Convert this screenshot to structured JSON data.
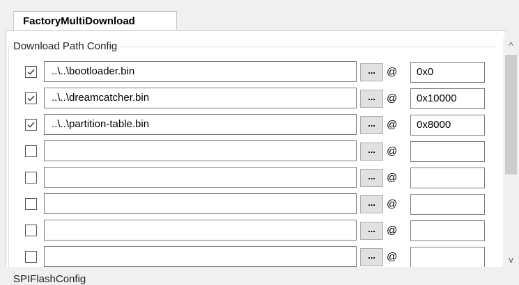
{
  "tab": {
    "label": "FactoryMultiDownload"
  },
  "group": {
    "title": "Download Path Config"
  },
  "browse_label": "...",
  "at_label": "@",
  "rows": [
    {
      "checked": true,
      "path": "..\\..\\bootloader.bin",
      "address": "0x0"
    },
    {
      "checked": true,
      "path": "..\\..\\dreamcatcher.bin",
      "address": "0x10000"
    },
    {
      "checked": true,
      "path": "..\\..\\partition-table.bin",
      "address": "0x8000"
    },
    {
      "checked": false,
      "path": "",
      "address": ""
    },
    {
      "checked": false,
      "path": "",
      "address": ""
    },
    {
      "checked": false,
      "path": "",
      "address": ""
    },
    {
      "checked": false,
      "path": "",
      "address": ""
    },
    {
      "checked": false,
      "path": "",
      "address": ""
    }
  ],
  "next_group": {
    "title": "SPIFlashConfig"
  },
  "scrollbar": {
    "up_icon": "chevron-up-icon",
    "down_icon": "chevron-down-icon",
    "up_glyph": "^",
    "down_glyph": "v"
  }
}
